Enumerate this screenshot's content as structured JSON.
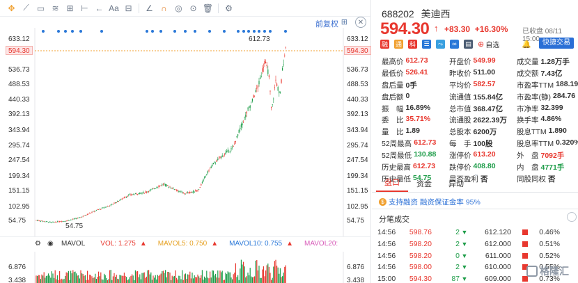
{
  "toolbar": {
    "restore_label": "前复权",
    "aa_label": "Aa"
  },
  "chart": {
    "y_labels": [
      "633.12",
      "594.30",
      "536.73",
      "488.53",
      "440.33",
      "392.13",
      "343.94",
      "295.74",
      "247.54",
      "199.34",
      "151.15",
      "102.95",
      "54.75"
    ],
    "current_price_tag": "594.30",
    "high_marker": "612.73",
    "low_marker": "54.75"
  },
  "volume": {
    "indicator": "MAVOL",
    "vol": "VOL: 1.275",
    "ma5": "MAVOL5: 0.750",
    "ma10": "MAVOL10: 0.755",
    "ma20": "MAVOL20:",
    "y_labels": [
      "6.876",
      "3.438"
    ]
  },
  "quote": {
    "code": "688202",
    "name": "美迪西",
    "price": "594.30",
    "change": "+83.30",
    "change_pct": "+16.30%",
    "status": "已收盘 08/11 15:00",
    "add_fav": "自选",
    "quick_trade": "快捷交易",
    "stats": [
      [
        {
          "k": "最高价",
          "v": "612.73",
          "c": "red"
        },
        {
          "k": "开盘价",
          "v": "549.99",
          "c": "red"
        },
        {
          "k": "成交量",
          "v": "1.28万手",
          "c": "dark"
        }
      ],
      [
        {
          "k": "最低价",
          "v": "526.41",
          "c": "red"
        },
        {
          "k": "昨收价",
          "v": "511.00",
          "c": "dark"
        },
        {
          "k": "成交额",
          "v": "7.43亿",
          "c": "dark"
        }
      ],
      [
        {
          "k": "盘后量",
          "v": "0手",
          "c": "dark"
        },
        {
          "k": "平均价",
          "v": "582.57",
          "c": "red"
        },
        {
          "k": "市盈率TTM",
          "v": "188.19",
          "c": "dark"
        }
      ],
      [
        {
          "k": "盘后额",
          "v": "0",
          "c": "dark"
        },
        {
          "k": "流通值",
          "v": "155.84亿",
          "c": "dark"
        },
        {
          "k": "市盈率(静)",
          "v": "284.76",
          "c": "dark"
        }
      ],
      [
        {
          "k": "振　幅",
          "v": "16.89%",
          "c": "dark"
        },
        {
          "k": "总市值",
          "v": "368.47亿",
          "c": "dark"
        },
        {
          "k": "市净率",
          "v": "32.399",
          "c": "dark"
        }
      ],
      [
        {
          "k": "委　比",
          "v": "35.71%",
          "c": "red"
        },
        {
          "k": "流通股",
          "v": "2622.39万",
          "c": "dark"
        },
        {
          "k": "换手率",
          "v": "4.86%",
          "c": "dark"
        }
      ],
      [
        {
          "k": "量　比",
          "v": "1.89",
          "c": "dark"
        },
        {
          "k": "总股本",
          "v": "6200万",
          "c": "dark"
        },
        {
          "k": "股息TTM",
          "v": "1.890",
          "c": "dark"
        }
      ],
      [
        {
          "k": "52周最高",
          "v": "612.73",
          "c": "red"
        },
        {
          "k": "每　手",
          "v": "100股",
          "c": "dark"
        },
        {
          "k": "股息率TTM",
          "v": "0.320%",
          "c": "dark"
        }
      ],
      [
        {
          "k": "52周最低",
          "v": "130.88",
          "c": "green"
        },
        {
          "k": "涨停价",
          "v": "613.20",
          "c": "red"
        },
        {
          "k": "外　盘",
          "v": "7092手",
          "c": "red"
        }
      ],
      [
        {
          "k": "历史最高",
          "v": "612.73",
          "c": "red"
        },
        {
          "k": "跌停价",
          "v": "408.80",
          "c": "green"
        },
        {
          "k": "内　盘",
          "v": "4771手",
          "c": "green"
        }
      ],
      [
        {
          "k": "历史最低",
          "v": "54.75",
          "c": "green"
        },
        {
          "k": "是否盈利",
          "v": "否",
          "c": "dark"
        },
        {
          "k": "同股同权",
          "v": "否",
          "c": "dark"
        }
      ]
    ]
  },
  "tabs": [
    "盘口",
    "资金",
    "异动"
  ],
  "margin_text": "支持融资  融资保证金率 95%",
  "ticks_title": "分笔成交",
  "ticks": [
    {
      "time": "14:56",
      "price": "598.76",
      "vol": "2",
      "dir": "down",
      "bid": "612.120",
      "pct": "0.46%"
    },
    {
      "time": "14:56",
      "price": "598.20",
      "vol": "2",
      "dir": "down",
      "bid": "612.000",
      "pct": "0.51%"
    },
    {
      "time": "14:56",
      "price": "598.20",
      "vol": "0",
      "dir": "down",
      "bid": "611.000",
      "pct": "0.52%"
    },
    {
      "time": "14:56",
      "price": "598.00",
      "vol": "2",
      "dir": "down",
      "bid": "610.000",
      "pct": "0.55%"
    },
    {
      "time": "15:00",
      "price": "594.30",
      "vol": "87",
      "dir": "down",
      "bid": "609.000",
      "pct": "0.73%"
    }
  ],
  "watermark": "格隆汇",
  "colors": {
    "up": "#e8382f",
    "down": "#1f9d4a",
    "accent": "#2a6fd6"
  }
}
